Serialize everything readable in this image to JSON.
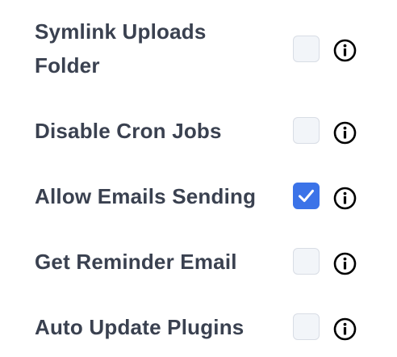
{
  "settings": [
    {
      "label": "Symlink Uploads Folder",
      "checked": false,
      "info_icon": "info-circle-icon"
    },
    {
      "label": "Disable Cron Jobs",
      "checked": false,
      "info_icon": "info-circle-icon"
    },
    {
      "label": "Allow Emails Sending",
      "checked": true,
      "info_icon": "info-circle-icon"
    },
    {
      "label": "Get Reminder Email",
      "checked": false,
      "info_icon": "info-circle-icon"
    },
    {
      "label": "Auto Update Plugins",
      "checked": false,
      "info_icon": "info-circle-icon"
    }
  ],
  "colors": {
    "label_text": "#3a4150",
    "checkbox_checked": "#3b73e8",
    "checkbox_unchecked_bg": "#f2f5f9",
    "checkbox_border": "#d8dde5"
  }
}
